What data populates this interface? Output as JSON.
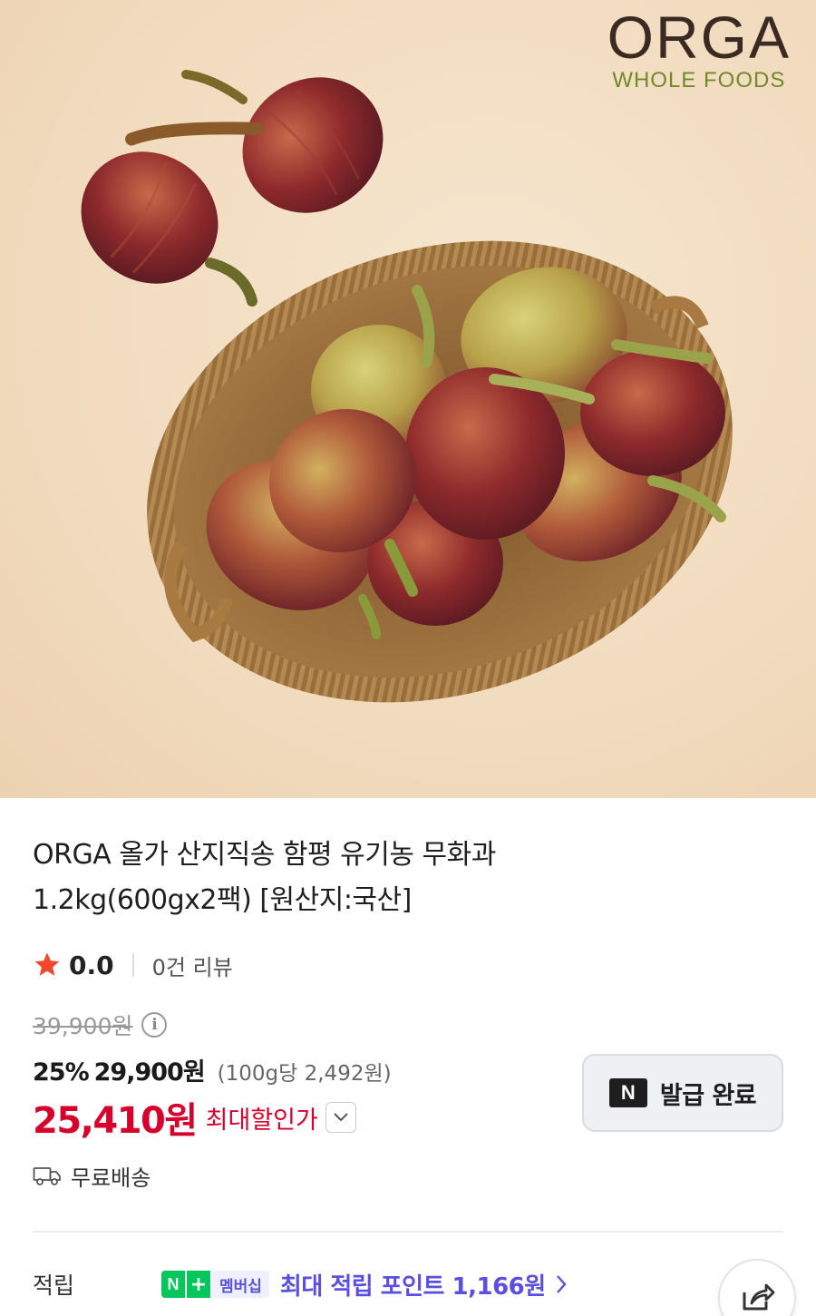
{
  "brand": {
    "name": "ORGA",
    "sub": "WHOLE FOODS"
  },
  "product": {
    "title_line1": "ORGA 올가 산지직송 함평 유기농 무화과",
    "title_line2": "1.2kg(600gx2팩) [원산지:국산]"
  },
  "rating": {
    "score": "0.0",
    "reviews": "0건 리뷰"
  },
  "pricing": {
    "original": "39,900원",
    "discount_percent": "25%",
    "sale": "29,900원",
    "unit": "(100g당 2,492원)",
    "max_discount_price": "25,410원",
    "max_discount_label": "최대할인가"
  },
  "coupon": {
    "badge": "N",
    "label": "발급 완료"
  },
  "shipping": {
    "label": "무료배송"
  },
  "points": {
    "label": "적립",
    "badge_n": "N",
    "badge_plus": "+",
    "badge_member": "멤버십",
    "text": "최대 적립 포인트 1,166원"
  },
  "colors": {
    "sale_red": "#d6002d",
    "naver_green": "#03c75a",
    "membership_purple": "#5b4fe0"
  },
  "icons": [
    "star-icon",
    "info-icon",
    "chevron-down-icon",
    "truck-icon",
    "chevron-right-icon",
    "share-icon"
  ]
}
